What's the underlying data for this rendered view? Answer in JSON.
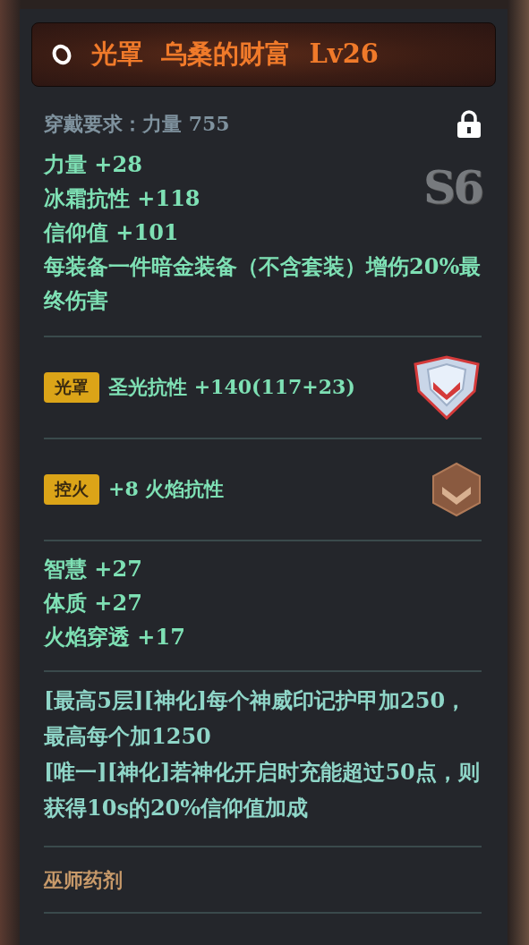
{
  "header": {
    "title": "光罩  乌桑的财富  Lv26"
  },
  "requirement": "穿戴要求：力量 755",
  "grade": "S6",
  "base_stats": [
    "力量  +28",
    "冰霜抗性  +118",
    "信仰值  +101"
  ],
  "base_effect": "每装备一件暗金装备（不含套装）增伤20%最终伤害",
  "gems": [
    {
      "tag": "光罩",
      "text": "圣光抗性  +140(117+23)",
      "kind": "silver"
    },
    {
      "tag": "控火",
      "text": "+8  火焰抗性",
      "kind": "bronze"
    }
  ],
  "extra_stats": [
    "智慧  +27",
    "体质  +27",
    "火焰穿透  +17"
  ],
  "effects": [
    "[最高5层][神化]每个神威印记护甲加250，最高每个加1250",
    "[唯一][神化]若神化开启时充能超过50点，则获得10s的20%信仰值加成"
  ],
  "potion": "巫师药剂"
}
